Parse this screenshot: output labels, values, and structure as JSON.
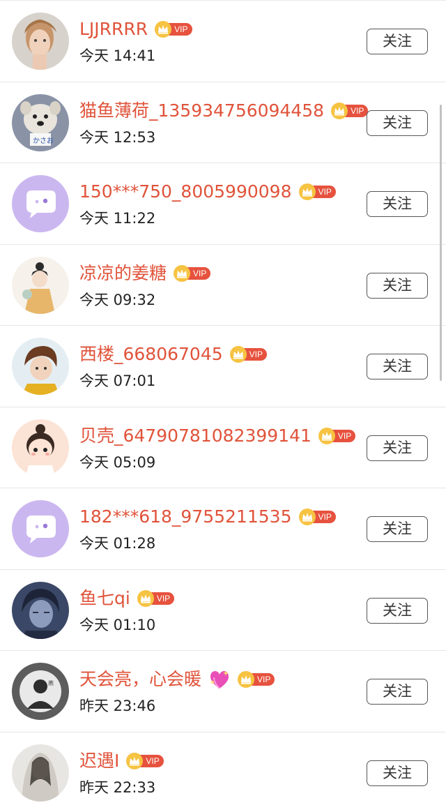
{
  "follow_label": "关注",
  "vip_label": "VIP",
  "colors": {
    "name": "#e0533a",
    "vip_badge": "#e6523e",
    "crown": "#f6c342"
  },
  "users": [
    {
      "name": "LJJRRRR",
      "time": "今天 14:41",
      "avatar": "photo-woman-icon"
    },
    {
      "name": "猫鱼薄荷_135934756094458",
      "time": "今天 12:53",
      "avatar": "dog-photo-icon"
    },
    {
      "name": "150***750_8005990098",
      "time": "今天 11:22",
      "avatar": "default-chat-avatar-icon"
    },
    {
      "name": "凉凉的姜糖",
      "time": "今天 09:32",
      "avatar": "illustration-girl-icon"
    },
    {
      "name": "西楼_668067045",
      "time": "今天 07:01",
      "avatar": "anime-boy-icon"
    },
    {
      "name": "贝壳_64790781082399141",
      "time": "今天 05:09",
      "avatar": "cartoon-child-icon"
    },
    {
      "name": "182***618_9755211535",
      "time": "今天 01:28",
      "avatar": "default-chat-avatar-icon"
    },
    {
      "name": "鱼七qi",
      "time": "今天 01:10",
      "avatar": "anime-man-icon"
    },
    {
      "name": "天会亮，心会暖",
      "time": "昨天 23:46",
      "avatar": "dark-character-icon",
      "emoji": "sparkling-heart-icon"
    },
    {
      "name": "迟遇I",
      "time": "昨天 22:33",
      "avatar": "veiled-woman-icon"
    }
  ]
}
